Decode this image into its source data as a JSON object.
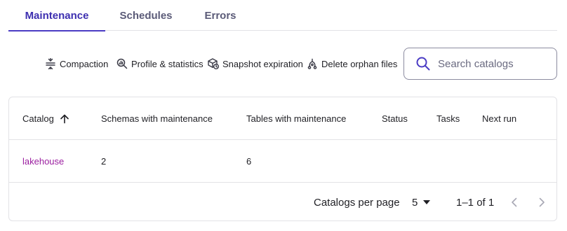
{
  "tabs": [
    {
      "label": "Maintenance",
      "active": true
    },
    {
      "label": "Schedules",
      "active": false
    },
    {
      "label": "Errors",
      "active": false
    }
  ],
  "toolbar": {
    "actions": [
      {
        "label": "Compaction",
        "icon": "compaction-icon"
      },
      {
        "label": "Profile & statistics",
        "icon": "profile-statistics-icon"
      },
      {
        "label": "Snapshot expiration",
        "icon": "snapshot-expiration-icon"
      },
      {
        "label": "Delete orphan files",
        "icon": "delete-orphan-files-icon"
      }
    ],
    "search": {
      "placeholder": "Search catalogs",
      "value": "",
      "icon": "search-icon"
    }
  },
  "table": {
    "columns": [
      "Catalog",
      "Schemas with maintenance",
      "Tables with maintenance",
      "Status",
      "Tasks",
      "Next run"
    ],
    "sort": {
      "column": "Catalog",
      "direction": "ascending",
      "icon": "arrow-up-icon"
    },
    "rows": [
      {
        "catalog": "lakehouse",
        "schemas": "2",
        "tables": "6",
        "status": "",
        "tasks": "",
        "next_run": ""
      }
    ]
  },
  "pagination": {
    "per_page_label": "Catalogs per page",
    "per_page_value": "5",
    "range_text": "1–1 of 1"
  },
  "colors": {
    "accent": "#4a3bc4",
    "link": "#9b1fa0",
    "border": "#e2e2e6"
  }
}
